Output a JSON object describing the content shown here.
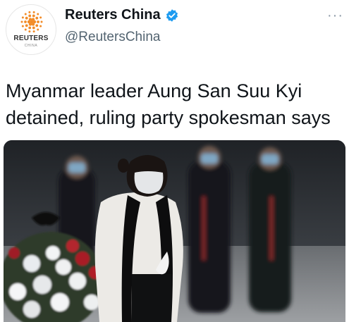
{
  "account": {
    "display_name": "Reuters China",
    "handle": "@ReutersChina",
    "avatar_word": "REUTERS",
    "avatar_sub": "CHINA",
    "verified_icon": "verified-badge-icon",
    "verified_color": "#1d9bf0"
  },
  "tweet": {
    "text": "Myanmar leader Aung San Suu Kyi detained, ruling party spokesman says",
    "more_label": "···"
  },
  "media": {
    "icon": "photo"
  },
  "colors": {
    "text": "#0f1419",
    "secondary": "#536471",
    "reuters_orange": "#f28c28"
  }
}
